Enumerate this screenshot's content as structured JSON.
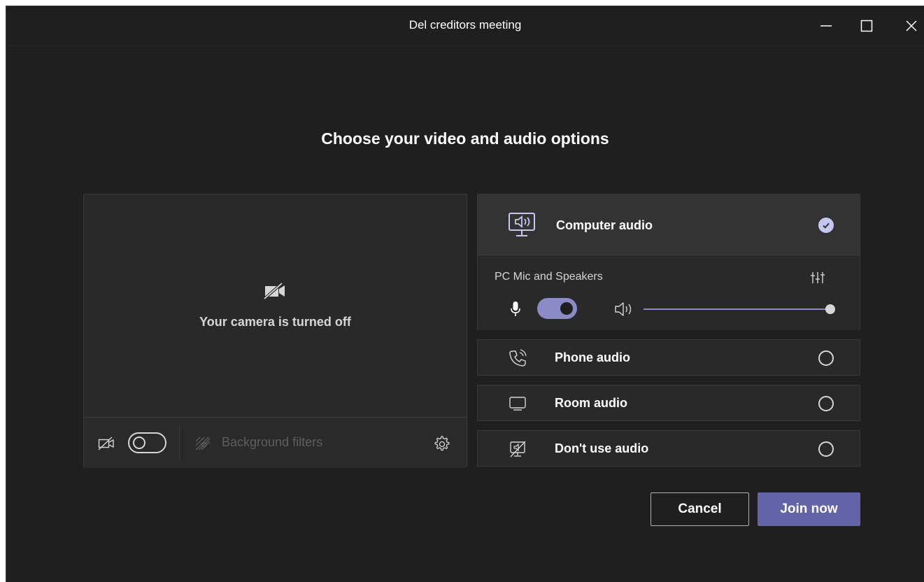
{
  "window": {
    "title": "Del creditors meeting"
  },
  "heading": "Choose your video and audio options",
  "video": {
    "camera_status": "Your camera is turned off",
    "camera_toggle_on": false,
    "background_filters_label": "Background filters"
  },
  "audio": {
    "options": [
      {
        "label": "Computer audio",
        "icon": "computer-speaker-icon",
        "selected": true
      },
      {
        "label": "Phone audio",
        "icon": "phone-icon",
        "selected": false
      },
      {
        "label": "Room audio",
        "icon": "monitor-icon",
        "selected": false
      },
      {
        "label": "Don't use audio",
        "icon": "no-audio-icon",
        "selected": false
      }
    ],
    "device_label": "PC Mic and Speakers",
    "mic_on": true,
    "volume_level": 1.0
  },
  "buttons": {
    "cancel": "Cancel",
    "join": "Join now"
  },
  "colors": {
    "background": "#1f1f1f",
    "panel": "#292929",
    "accent": "#6264a7",
    "toggle_on": "#8b8cc7",
    "check": "#c5c7f0"
  }
}
